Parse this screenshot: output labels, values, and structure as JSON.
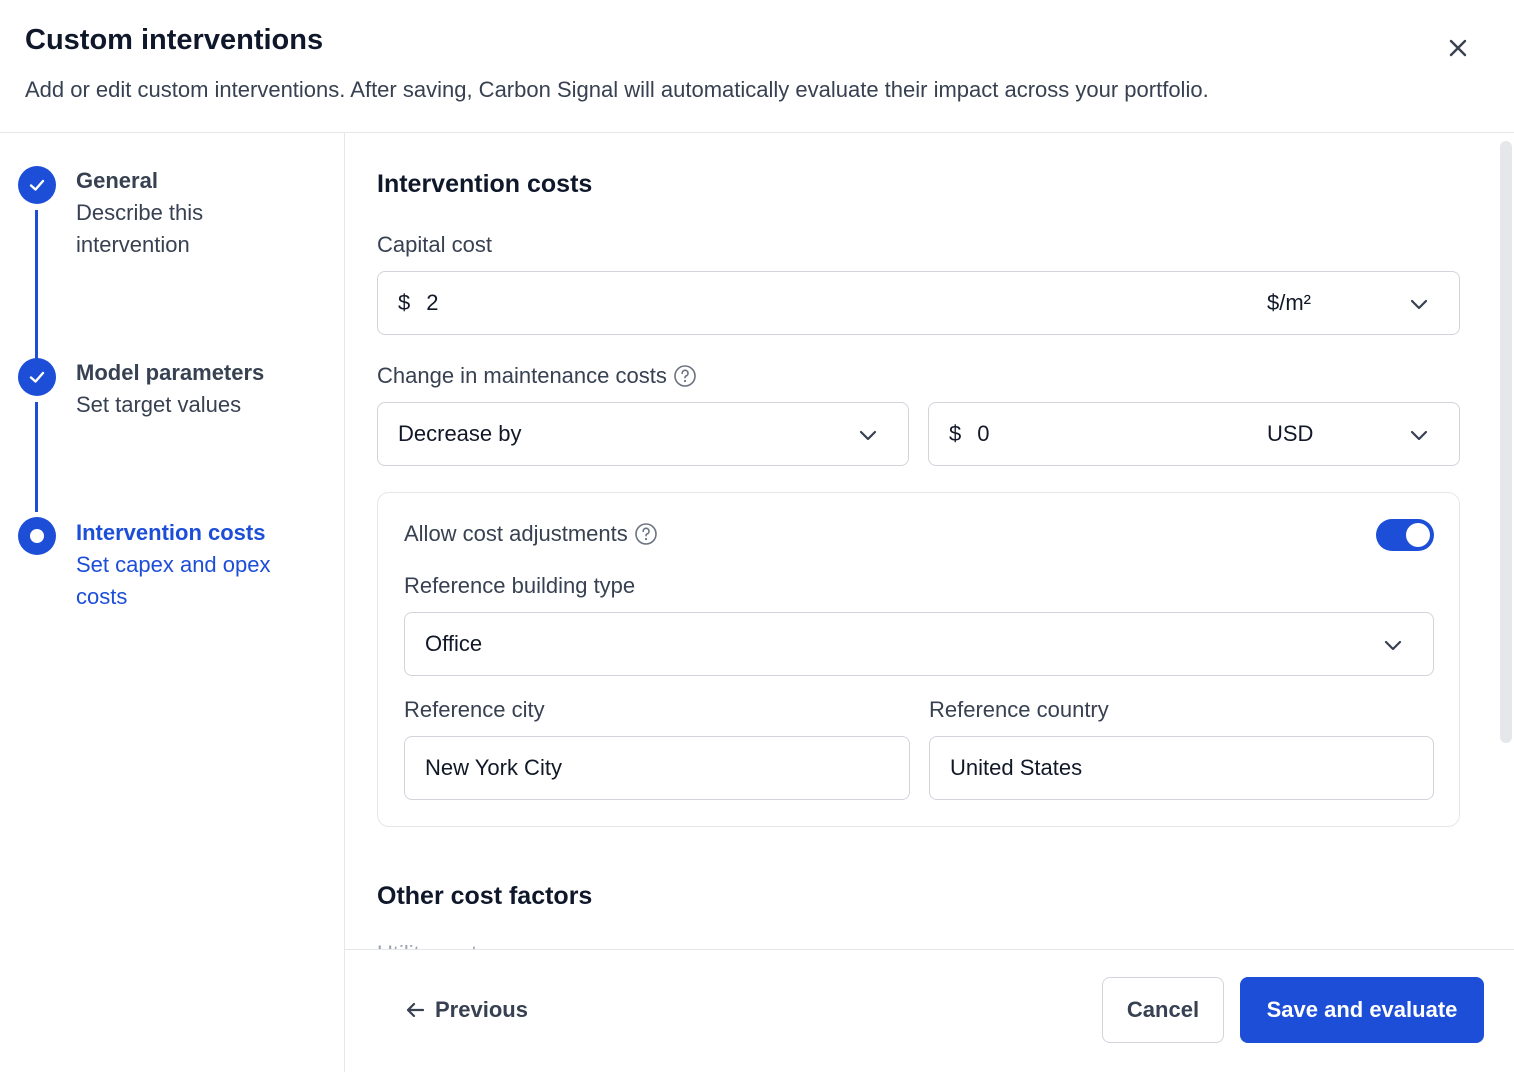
{
  "header": {
    "title": "Custom interventions",
    "subtitle": "Add or edit custom interventions. After saving, Carbon Signal will automatically evaluate their impact across your portfolio.",
    "close_icon": "close-icon"
  },
  "steps": [
    {
      "title": "General",
      "description": "Describe this intervention",
      "status": "complete"
    },
    {
      "title": "Model parameters",
      "description": "Set target values",
      "status": "complete"
    },
    {
      "title": "Intervention costs",
      "description": "Set capex and opex costs",
      "status": "current"
    }
  ],
  "content": {
    "section_title": "Intervention costs",
    "capital_cost": {
      "label": "Capital cost",
      "prefix": "$",
      "value": "2",
      "unit": "$/m²"
    },
    "maintenance": {
      "label": "Change in maintenance costs",
      "direction": "Decrease by",
      "prefix": "$",
      "value": "0",
      "unit": "USD"
    },
    "adjustments": {
      "label": "Allow cost adjustments",
      "enabled": true,
      "building_type_label": "Reference building type",
      "building_type": "Office",
      "city_label": "Reference city",
      "city": "New York City",
      "country_label": "Reference country",
      "country": "United States"
    },
    "other_title": "Other cost factors",
    "next_field_label": "Utility costs"
  },
  "footer": {
    "previous_label": "Previous",
    "cancel_label": "Cancel",
    "save_label": "Save and evaluate"
  },
  "colors": {
    "accent": "#1d4ed8",
    "border": "#d1d5db",
    "text": "#374151"
  }
}
